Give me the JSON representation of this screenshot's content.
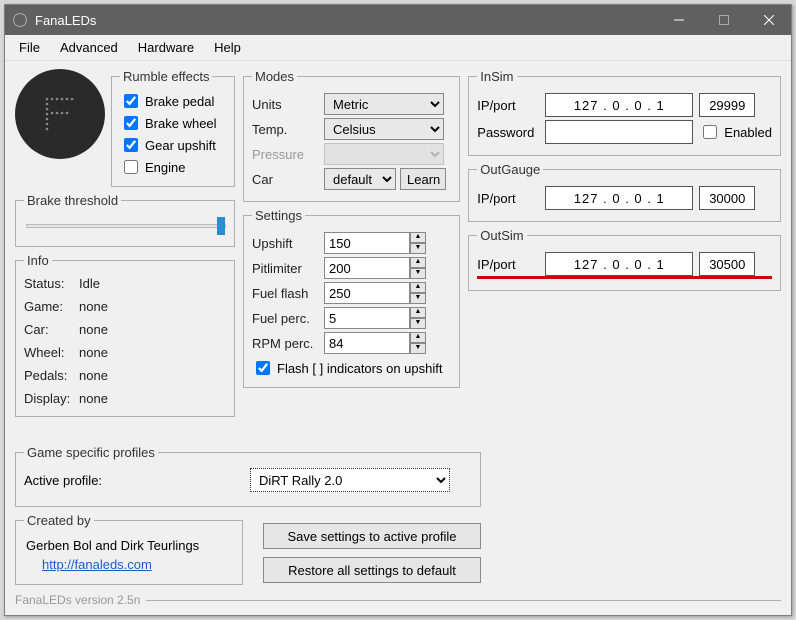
{
  "titlebar": {
    "title": "FanaLEDs"
  },
  "menus": {
    "file": "File",
    "advanced": "Advanced",
    "hardware": "Hardware",
    "help": "Help"
  },
  "rumble": {
    "legend": "Rumble effects",
    "brake_pedal": "Brake pedal",
    "brake_wheel": "Brake wheel",
    "gear_upshift": "Gear upshift",
    "engine": "Engine"
  },
  "brake_threshold": {
    "legend": "Brake threshold"
  },
  "info": {
    "legend": "Info",
    "status_l": "Status:",
    "status_v": "Idle",
    "game_l": "Game:",
    "game_v": "none",
    "car_l": "Car:",
    "car_v": "none",
    "wheel_l": "Wheel:",
    "wheel_v": "none",
    "pedals_l": "Pedals:",
    "pedals_v": "none",
    "display_l": "Display:",
    "display_v": "none"
  },
  "modes": {
    "legend": "Modes",
    "units_l": "Units",
    "units_v": "Metric",
    "temp_l": "Temp.",
    "temp_v": "Celsius",
    "pressure_l": "Pressure",
    "pressure_v": "",
    "car_l": "Car",
    "car_v": "default",
    "learn": "Learn"
  },
  "settings": {
    "legend": "Settings",
    "upshift_l": "Upshift",
    "upshift_v": "150",
    "pitlimiter_l": "Pitlimiter",
    "pitlimiter_v": "200",
    "fuelflash_l": "Fuel flash",
    "fuelflash_v": "250",
    "fuelperc_l": "Fuel perc.",
    "fuelperc_v": "5",
    "rpmperc_l": "RPM perc.",
    "rpmperc_v": "84",
    "flash_l": "Flash [ ] indicators on upshift"
  },
  "insim": {
    "legend": "InSim",
    "ipport_l": "IP/port",
    "ip": "127 .  0  .  0  .  1",
    "port": "29999",
    "password_l": "Password",
    "enabled_l": "Enabled"
  },
  "outgauge": {
    "legend": "OutGauge",
    "ipport_l": "IP/port",
    "ip": "127 .  0  .  0  .  1",
    "port": "30000"
  },
  "outsim": {
    "legend": "OutSim",
    "ipport_l": "IP/port",
    "ip": "127 .  0  .  0  .  1",
    "port": "30500"
  },
  "profiles": {
    "legend": "Game specific profiles",
    "active_l": "Active profile:",
    "active_v": "DiRT Rally 2.0"
  },
  "created": {
    "legend": "Created by",
    "text": "Gerben Bol and Dirk Teurlings",
    "link": "http://fanaleds.com"
  },
  "actions": {
    "save": "Save settings to active profile",
    "restore": "Restore all settings to default"
  },
  "footer": {
    "version": "FanaLEDs version 2.5n"
  }
}
